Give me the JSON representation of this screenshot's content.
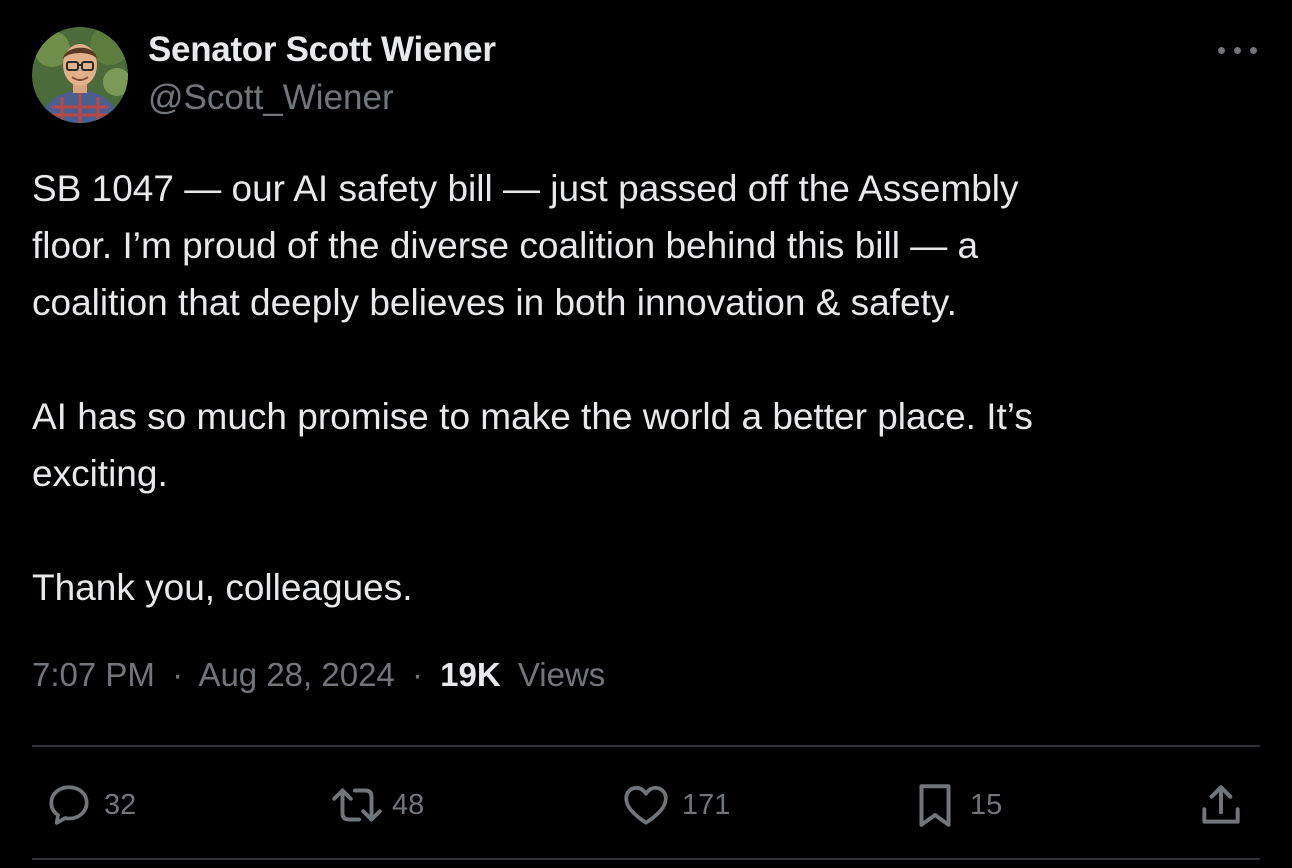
{
  "tweet": {
    "author": {
      "display_name": "Senator Scott Wiener",
      "handle": "@Scott_Wiener"
    },
    "body": {
      "line1": "SB 1047 — our AI safety bill — just passed off the Assembly",
      "line2": "floor. I’m proud of the diverse coalition behind this bill — a",
      "line3": "coalition that deeply believes in both innovation & safety.",
      "line4": "AI has so much promise to make the world a better place. It’s",
      "line5": "exciting.",
      "line6": "Thank you, colleagues."
    },
    "meta": {
      "time": "7:07 PM",
      "separator": "·",
      "date": "Aug 28, 2024",
      "views_count": "19K",
      "views_label": "Views"
    },
    "actions": {
      "replies": "32",
      "reposts": "48",
      "likes": "171",
      "bookmarks": "15"
    },
    "icons": {
      "more": "more-icon",
      "reply": "reply-icon",
      "repost": "repost-icon",
      "like": "heart-icon",
      "bookmark": "bookmark-icon",
      "share": "share-icon"
    }
  },
  "colors": {
    "background": "#000000",
    "primary_text": "#e7e9ea",
    "secondary_text": "#71767b",
    "divider": "#2f3336"
  }
}
